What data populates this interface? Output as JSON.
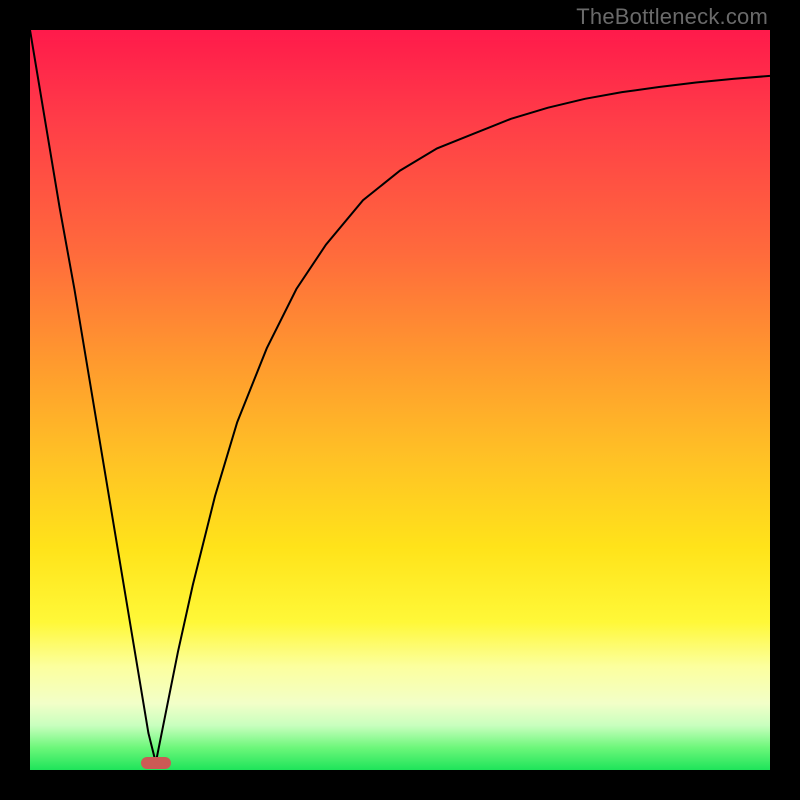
{
  "watermark": "TheBottleneck.com",
  "colors": {
    "frame": "#000000",
    "curve": "#000000",
    "minpoint": "#cc5a55",
    "gradient_top": "#ff1a4b",
    "gradient_bottom": "#1ee45a"
  },
  "chart_data": {
    "type": "line",
    "title": "",
    "xlabel": "",
    "ylabel": "",
    "xlim": [
      0,
      100
    ],
    "ylim": [
      0,
      100
    ],
    "min_point": {
      "x": 17,
      "y": 1
    },
    "series": [
      {
        "name": "left-branch",
        "x": [
          0,
          2,
          4,
          6,
          8,
          10,
          12,
          14,
          15,
          16,
          17
        ],
        "values": [
          100,
          88,
          76,
          65,
          53,
          41,
          29,
          17,
          11,
          5,
          1
        ]
      },
      {
        "name": "right-branch",
        "x": [
          17,
          18,
          20,
          22,
          25,
          28,
          32,
          36,
          40,
          45,
          50,
          55,
          60,
          65,
          70,
          75,
          80,
          85,
          90,
          95,
          100
        ],
        "values": [
          1,
          6,
          16,
          25,
          37,
          47,
          57,
          65,
          71,
          77,
          81,
          84,
          86,
          88,
          89.5,
          90.7,
          91.6,
          92.3,
          92.9,
          93.4,
          93.8
        ]
      }
    ],
    "annotations": []
  }
}
